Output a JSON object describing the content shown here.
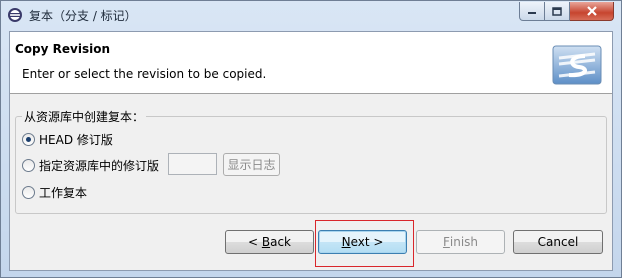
{
  "window": {
    "title": "复本（分支 / 标记）",
    "icons": {
      "app": "eclipse-icon",
      "minimize": "minimize-icon",
      "maximize": "maximize-icon",
      "close": "close-icon"
    }
  },
  "header": {
    "title": "Copy Revision",
    "description": "Enter or select the revision to be copied.",
    "icon": "subversion-logo-icon"
  },
  "group": {
    "label": "从资源库中创建复本：",
    "options": [
      {
        "label": "HEAD 修订版",
        "selected": true
      },
      {
        "label": "指定资源库中的修订版",
        "selected": false
      },
      {
        "label": "工作复本",
        "selected": false
      }
    ],
    "revision_input": {
      "value": "",
      "enabled": false
    },
    "show_log_label": "显示日志"
  },
  "buttons": {
    "back_mnemonic": "B",
    "back_rest": "ack",
    "back_prefix": "< ",
    "next_mnemonic": "N",
    "next_rest": "ext >",
    "finish_mnemonic": "F",
    "finish_rest": "inish",
    "cancel_label": "Cancel"
  },
  "colors": {
    "highlight": "#d9262b",
    "accent": "#3c7fb1"
  }
}
